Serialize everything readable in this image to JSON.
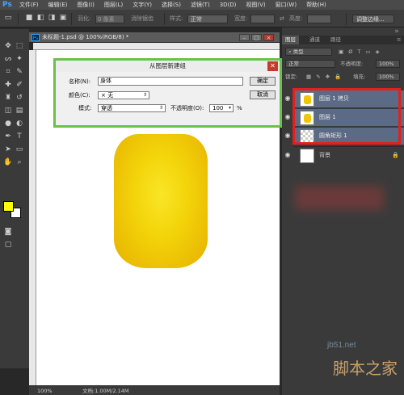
{
  "app": {
    "logo": "Ps"
  },
  "menu": [
    "文件(F)",
    "编辑(E)",
    "图像(I)",
    "图层(L)",
    "文字(Y)",
    "选择(S)",
    "滤镜(T)",
    "3D(D)",
    "视图(V)",
    "窗口(W)",
    "帮助(H)"
  ],
  "options": {
    "feather_label": "羽化:",
    "feather_value": "0 像素",
    "antialias_label": "消除锯齿",
    "style_label": "样式:",
    "style_value": "正常",
    "width_label": "宽度:",
    "height_label": "高度:",
    "refine_button": "调整边缘..."
  },
  "document": {
    "tab_title": "未标题-1.psd @ 100%(RGB/8) *",
    "zoom": "100%",
    "doc_info": "文档:1.00M/2.14M"
  },
  "dialog": {
    "title": "从图层新建组",
    "name_label": "名称(N):",
    "name_value": "身体",
    "color_label": "颜色(C):",
    "color_value": "无",
    "mode_label": "模式:",
    "mode_value": "穿透",
    "opacity_label": "不透明度(O):",
    "opacity_value": "100",
    "opacity_unit": "%",
    "ok_button": "确定",
    "cancel_button": "取消"
  },
  "panel": {
    "tabs": [
      "图层",
      "通道",
      "路径"
    ],
    "filter_label": "类型",
    "blend_value": "正常",
    "opacity_label": "不透明度:",
    "opacity_value": "100%",
    "lock_label": "锁定:",
    "fill_label": "填充:",
    "fill_value": "100%",
    "layers": [
      {
        "name": "图层 1 拷贝",
        "selected": true
      },
      {
        "name": "图层 1",
        "selected": true
      },
      {
        "name": "圆角矩形 1",
        "selected": true
      },
      {
        "name": "背景",
        "selected": false
      }
    ]
  },
  "watermark": {
    "site": "jb51.net",
    "brand": "脚本之家"
  },
  "colors": {
    "foreground": "#ffff00",
    "background": "#ffffff",
    "highlight": "#e3201b",
    "dialog_border": "#6cc04a"
  }
}
